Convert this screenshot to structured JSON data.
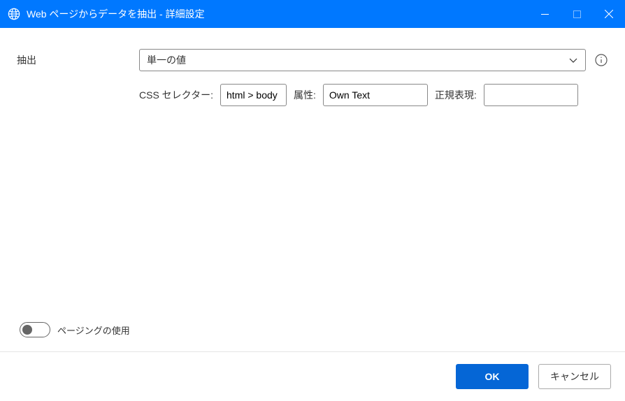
{
  "titlebar": {
    "title": "Web ページからデータを抽出 - 詳細設定"
  },
  "form": {
    "extract_label": "抽出",
    "extract_select": {
      "value": "単一の値"
    },
    "css_label": "CSS セレクター:",
    "css_value": "html > body",
    "attr_label": "属性:",
    "attr_value": "Own Text",
    "regex_label": "正規表現:",
    "regex_value": ""
  },
  "paging": {
    "label": "ページングの使用",
    "enabled": false
  },
  "buttons": {
    "ok": "OK",
    "cancel": "キャンセル"
  }
}
